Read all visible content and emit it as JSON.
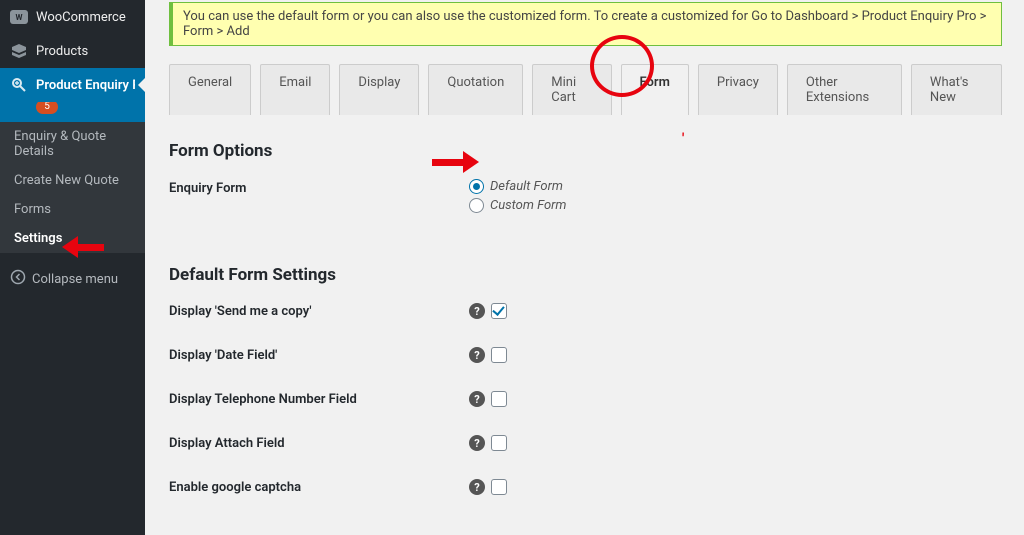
{
  "sidebar": {
    "woocommerce": "WooCommerce",
    "products": "Products",
    "pep": "Product Enquiry Pro",
    "pep_badge": "5",
    "sub_enquiry": "Enquiry & Quote Details",
    "sub_create": "Create New Quote",
    "sub_forms": "Forms",
    "sub_settings": "Settings",
    "collapse": "Collapse menu"
  },
  "notice": "You can use the default form or you can also use the customized form. To create a customized for Go to Dashboard > Product Enquiry Pro > Form > Add ",
  "tabs": {
    "general": "General",
    "email": "Email",
    "display": "Display",
    "quotation": "Quotation",
    "minicart": "Mini Cart",
    "form": "Form",
    "privacy": "Privacy",
    "other": "Other Extensions",
    "whatsnew": "What's New"
  },
  "headings": {
    "form_options": "Form Options",
    "default_form_settings": "Default Form Settings"
  },
  "labels": {
    "enquiry_form": "Enquiry Form",
    "default_form": "Default Form",
    "custom_form": "Custom Form",
    "send_copy": "Display 'Send me a copy'",
    "date_field": "Display 'Date Field'",
    "tel_field": "Display Telephone Number Field",
    "attach_field": "Display Attach Field",
    "captcha": "Enable google captcha"
  }
}
